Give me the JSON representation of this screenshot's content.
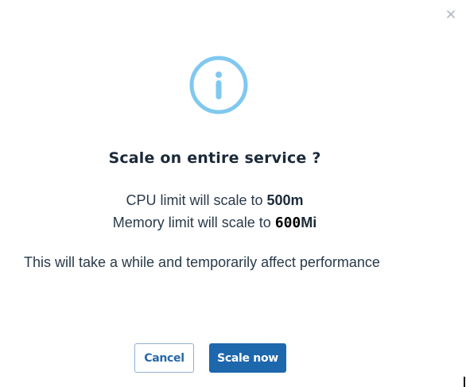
{
  "dialog": {
    "title": "Scale on entire service ?",
    "cpu_text": "CPU limit will scale to ",
    "cpu_value": "500m",
    "memory_text": "Memory limit will scale to ",
    "memory_value_number": "600",
    "memory_value_unit": "Mi",
    "message": "This will take a while and temporarily affect performance",
    "cancel_label": "Cancel",
    "confirm_label": "Scale now",
    "icons": {
      "close": "close-icon",
      "info": "info-icon"
    },
    "colors": {
      "primary": "#1d67ad",
      "info_icon": "#7fc8ef",
      "cancel_border": "#8fb1d3",
      "text": "#2a3a4a"
    }
  }
}
